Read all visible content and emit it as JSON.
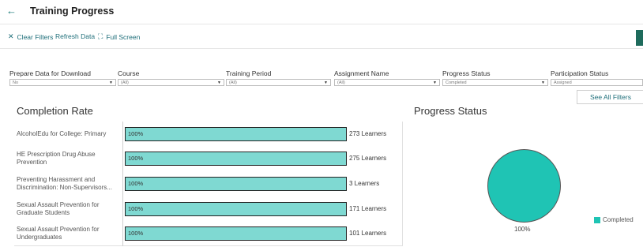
{
  "header": {
    "back_glyph": "←",
    "title": "Training Progress"
  },
  "toolbar": {
    "clear_filters": "Clear Filters",
    "refresh_data": "Refresh Data",
    "full_screen": "Full Screen",
    "icons": {
      "clear": "close-icon",
      "refresh": "none",
      "fullscreen": "fullscreen-icon"
    }
  },
  "filters": [
    {
      "label": "Prepare Data for Download",
      "value": "No"
    },
    {
      "label": "Course",
      "value": "(All)"
    },
    {
      "label": "Training Period",
      "value": "(All)"
    },
    {
      "label": "Assignment Name",
      "value": "(All)"
    },
    {
      "label": "Progress Status",
      "value": "Completed"
    },
    {
      "label": "Participation Status",
      "value": "Assigned"
    }
  ],
  "see_all_filters": "See All Filters",
  "completion_rate": {
    "title": "Completion Rate",
    "rows": [
      {
        "course": "AlcoholEdu for College: Primary",
        "percent": "100%",
        "learners": "273 Learners",
        "value": 1.0
      },
      {
        "course": "HE Prescription Drug Abuse Prevention",
        "percent": "100%",
        "learners": "275 Learners",
        "value": 1.0
      },
      {
        "course": "Preventing Harassment and Discrimination: Non-Supervisors...",
        "percent": "100%",
        "learners": "3 Learners",
        "value": 1.0
      },
      {
        "course": "Sexual Assault Prevention for Graduate Students",
        "percent": "100%",
        "learners": "171 Learners",
        "value": 1.0
      },
      {
        "course": "Sexual Assault Prevention for Undergraduates",
        "percent": "100%",
        "learners": "101 Learners",
        "value": 1.0
      }
    ]
  },
  "progress_status": {
    "title": "Progress Status",
    "slices": [
      {
        "name": "Completed",
        "percent": "100%",
        "value": 100,
        "color": "#1fc4b4"
      }
    ],
    "legend_entry": "Completed"
  },
  "colors": {
    "accent": "#1f6f7a",
    "bar": "#7fd9d2",
    "pie": "#1fc4b4"
  }
}
